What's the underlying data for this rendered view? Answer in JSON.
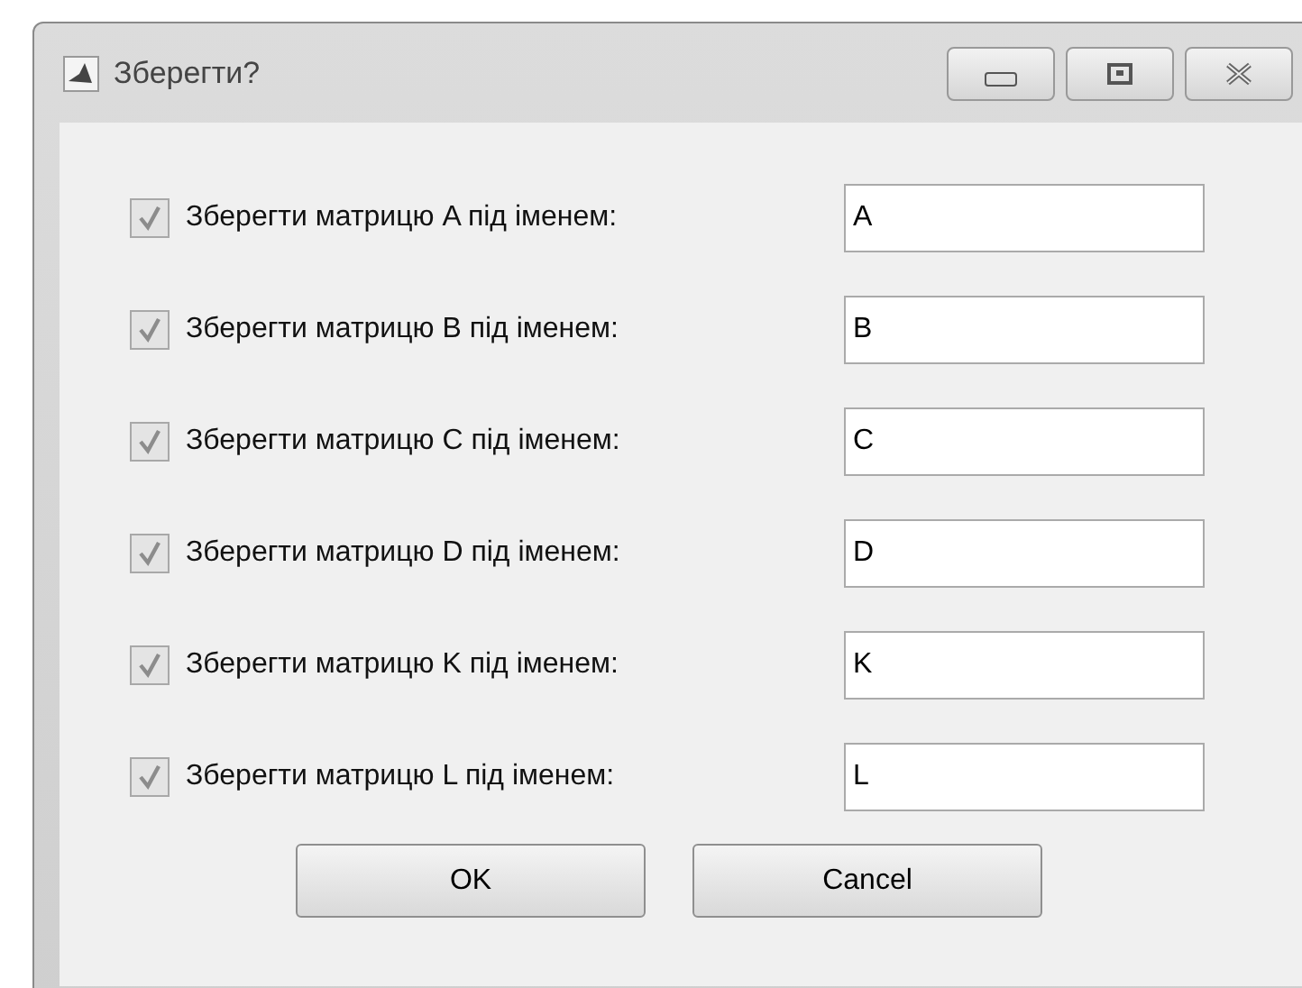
{
  "window": {
    "title": "Зберегти?"
  },
  "rows": [
    {
      "label": "Зберегти матрицю A під іменем:",
      "checked": true,
      "value": "A"
    },
    {
      "label": "Зберегти матрицю B під іменем:",
      "checked": true,
      "value": "B"
    },
    {
      "label": "Зберегти матрицю C під іменем:",
      "checked": true,
      "value": "C"
    },
    {
      "label": "Зберегти матрицю D під іменем:",
      "checked": true,
      "value": "D"
    },
    {
      "label": "Зберегти матрицю K під іменем:",
      "checked": true,
      "value": "K"
    },
    {
      "label": "Зберегти матрицю L під іменем:",
      "checked": true,
      "value": "L"
    }
  ],
  "buttons": [
    "OK",
    "Cancel"
  ]
}
